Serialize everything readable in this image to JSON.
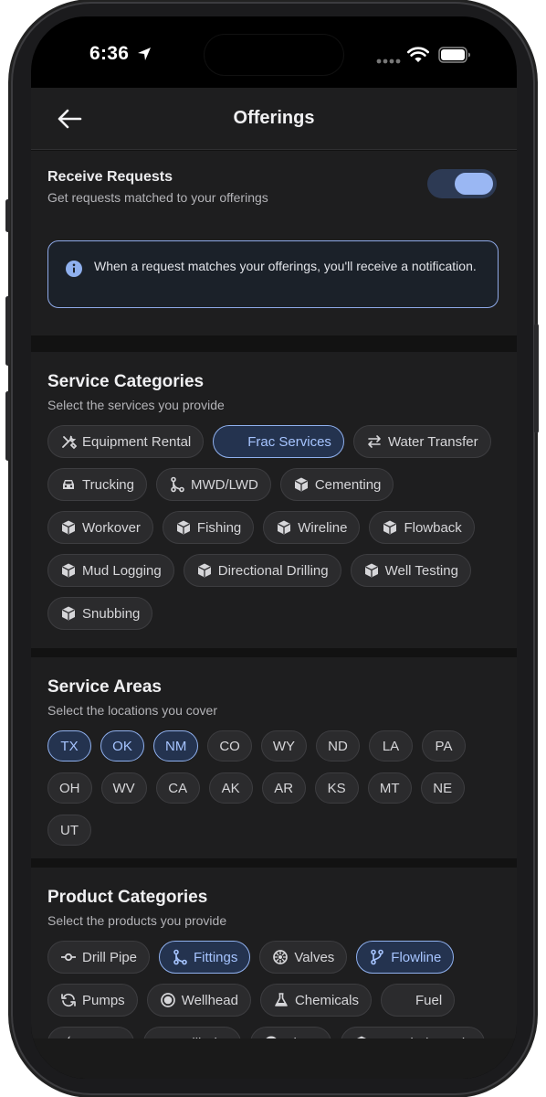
{
  "status": {
    "time": "6:36"
  },
  "header": {
    "title": "Offerings"
  },
  "receive": {
    "title": "Receive Requests",
    "subtitle": "Get requests matched to your offerings",
    "enabled": true
  },
  "info": {
    "text": "When a request matches your offerings, you'll receive a notification."
  },
  "service_categories": {
    "title": "Service Categories",
    "subtitle": "Select the services you provide",
    "items": [
      {
        "label": "Equipment Rental",
        "icon": "tools-icon",
        "selected": false
      },
      {
        "label": "Frac Services",
        "icon": "droplet-icon",
        "selected": true
      },
      {
        "label": "Water Transfer",
        "icon": "transfer-icon",
        "selected": false
      },
      {
        "label": "Trucking",
        "icon": "truck-icon",
        "selected": false
      },
      {
        "label": "MWD/LWD",
        "icon": "branch-icon",
        "selected": false
      },
      {
        "label": "Cementing",
        "icon": "cube-icon",
        "selected": false
      },
      {
        "label": "Workover",
        "icon": "cube-icon",
        "selected": false
      },
      {
        "label": "Fishing",
        "icon": "cube-icon",
        "selected": false
      },
      {
        "label": "Wireline",
        "icon": "cube-icon",
        "selected": false
      },
      {
        "label": "Flowback",
        "icon": "cube-icon",
        "selected": false
      },
      {
        "label": "Mud Logging",
        "icon": "cube-icon",
        "selected": false
      },
      {
        "label": "Directional Drilling",
        "icon": "cube-icon",
        "selected": false
      },
      {
        "label": "Well Testing",
        "icon": "cube-icon",
        "selected": false
      },
      {
        "label": "Snubbing",
        "icon": "cube-icon",
        "selected": false
      }
    ]
  },
  "service_areas": {
    "title": "Service Areas",
    "subtitle": "Select the locations you cover",
    "items": [
      {
        "label": "TX",
        "selected": true
      },
      {
        "label": "OK",
        "selected": true
      },
      {
        "label": "NM",
        "selected": true
      },
      {
        "label": "CO",
        "selected": false
      },
      {
        "label": "WY",
        "selected": false
      },
      {
        "label": "ND",
        "selected": false
      },
      {
        "label": "LA",
        "selected": false
      },
      {
        "label": "PA",
        "selected": false
      },
      {
        "label": "OH",
        "selected": false
      },
      {
        "label": "WV",
        "selected": false
      },
      {
        "label": "CA",
        "selected": false
      },
      {
        "label": "AK",
        "selected": false
      },
      {
        "label": "AR",
        "selected": false
      },
      {
        "label": "KS",
        "selected": false
      },
      {
        "label": "MT",
        "selected": false
      },
      {
        "label": "NE",
        "selected": false
      },
      {
        "label": "UT",
        "selected": false
      }
    ]
  },
  "product_categories": {
    "title": "Product Categories",
    "subtitle": "Select the products you provide",
    "items": [
      {
        "label": "Drill Pipe",
        "icon": "pipe-icon",
        "selected": false
      },
      {
        "label": "Fittings",
        "icon": "branch-icon",
        "selected": true
      },
      {
        "label": "Valves",
        "icon": "valve-icon",
        "selected": false
      },
      {
        "label": "Flowline",
        "icon": "flowline-icon",
        "selected": true
      },
      {
        "label": "Pumps",
        "icon": "refresh-icon",
        "selected": false
      },
      {
        "label": "Wellhead",
        "icon": "wellhead-icon",
        "selected": false
      },
      {
        "label": "Chemicals",
        "icon": "flask-icon",
        "selected": false
      },
      {
        "label": "Fuel",
        "icon": "flame-icon",
        "selected": false
      },
      {
        "label": "Power",
        "icon": "bolt-icon",
        "selected": false
      },
      {
        "label": "Drill Bits",
        "icon": "droplet-icon",
        "selected": false
      },
      {
        "label": "Plugs",
        "icon": "circle-icon",
        "selected": false
      },
      {
        "label": "Downhole Tools",
        "icon": "cube-icon",
        "selected": false
      }
    ]
  }
}
